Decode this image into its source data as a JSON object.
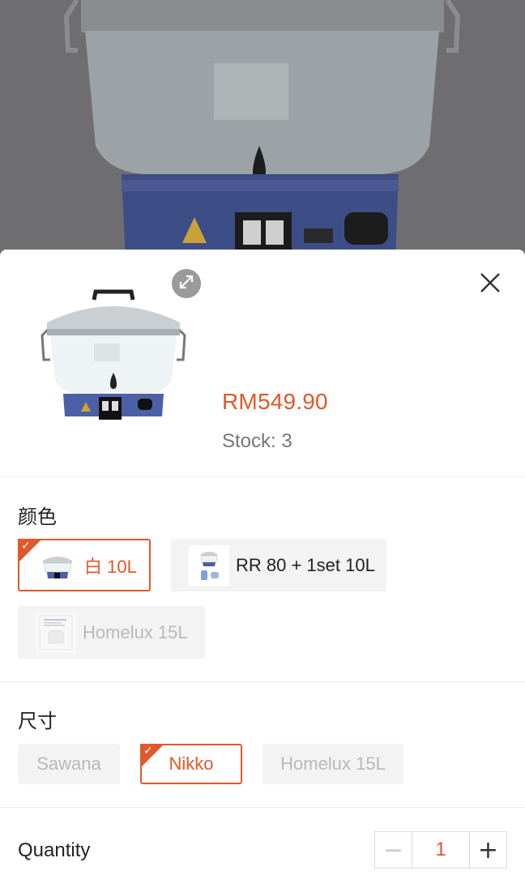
{
  "product": {
    "price": "RM549.90",
    "stock": "Stock: 3"
  },
  "icons": {
    "expand": "expand-icon",
    "close": "close-icon",
    "check": "check-icon",
    "minus": "minus-icon",
    "plus": "plus-icon"
  },
  "colors": {
    "accent": "#e0582b",
    "overlay": "#6f6f70"
  },
  "color_section": {
    "title": "颜色",
    "options": [
      {
        "label": "白 10L",
        "state": "selected"
      },
      {
        "label": "RR 80 + 1set 10L",
        "state": "available"
      },
      {
        "label": "Homelux 15L",
        "state": "disabled"
      }
    ]
  },
  "size_section": {
    "title": "尺寸",
    "options": [
      {
        "label": "Sawana",
        "state": "disabled"
      },
      {
        "label": "Nikko",
        "state": "selected"
      },
      {
        "label": "Homelux 15L",
        "state": "disabled"
      }
    ]
  },
  "quantity": {
    "label": "Quantity",
    "value": "1",
    "minus": "−",
    "plus": "+"
  }
}
